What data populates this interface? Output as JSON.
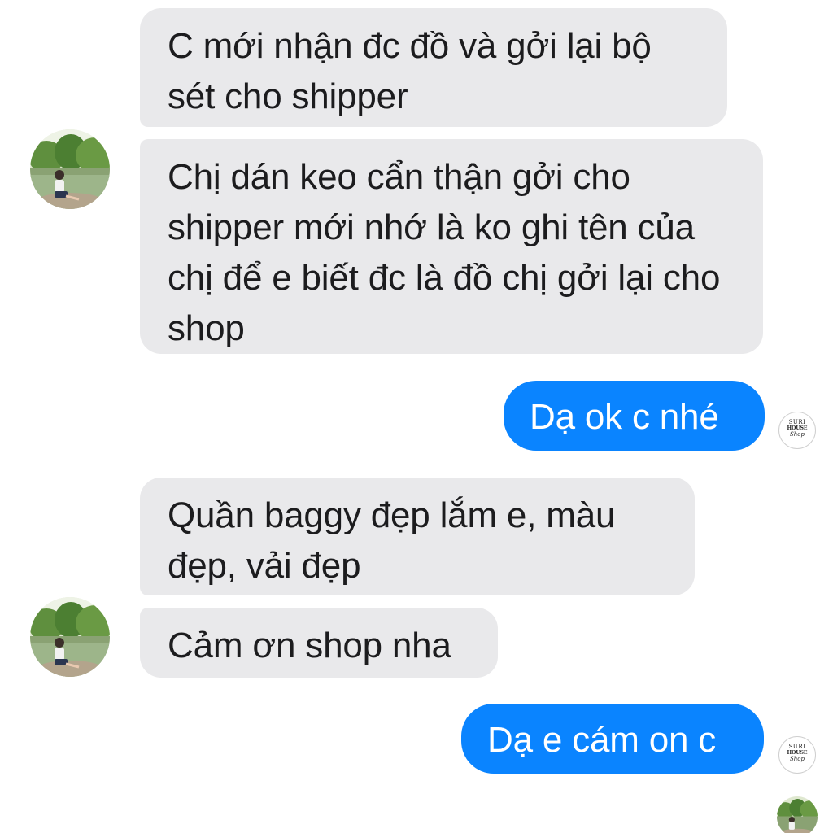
{
  "conversation": {
    "messages": [
      {
        "id": "msg1",
        "sender": "customer",
        "text": "C mới nhận đc đồ và gởi lại bộ sét cho shipper"
      },
      {
        "id": "msg2",
        "sender": "customer",
        "text": "Chị dán keo cẩn thận gởi cho shipper mới nhớ là ko ghi tên của chị để e biết đc là đồ chị gởi lại cho shop"
      },
      {
        "id": "msg3",
        "sender": "shop",
        "text": "Dạ ok c nhé"
      },
      {
        "id": "msg4",
        "sender": "customer",
        "text": "Quần baggy đẹp lắm e, màu đẹp, vải đẹp"
      },
      {
        "id": "msg5",
        "sender": "customer",
        "text": "Cảm ơn shop nha"
      },
      {
        "id": "msg6",
        "sender": "shop",
        "text": "Dạ e cám on c"
      }
    ]
  },
  "shop_logo": {
    "line1": "SURI",
    "line2": "HOUSE",
    "line3": "Shop"
  },
  "colors": {
    "incoming_bubble": "#e9e9eb",
    "outgoing_bubble": "#0a84ff",
    "incoming_text": "#1c1c1e",
    "outgoing_text": "#ffffff"
  },
  "icons": {
    "customer_avatar": "customer-photo-avatar",
    "shop_avatar": "shop-logo-avatar",
    "seen_indicator": "seen-avatar"
  }
}
